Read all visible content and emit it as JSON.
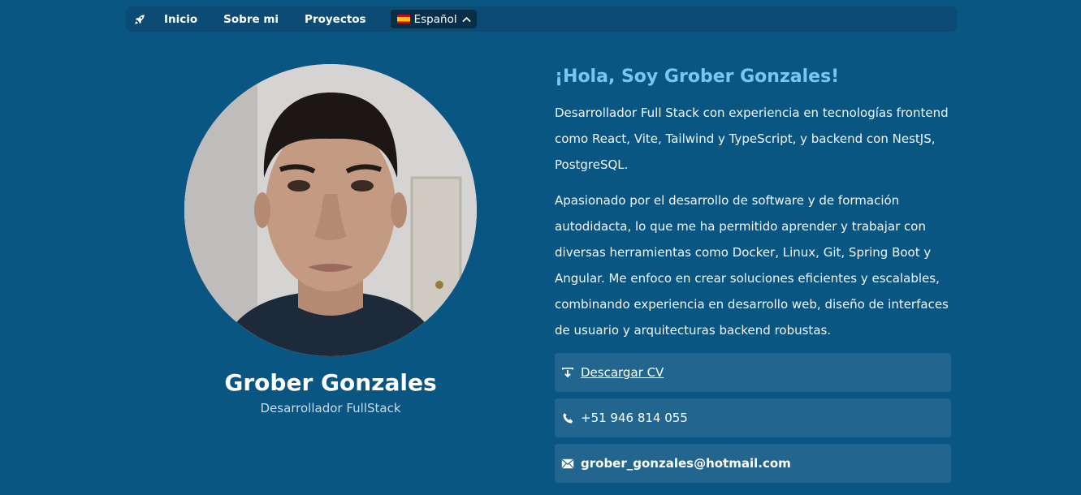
{
  "nav": {
    "logo_icon": "rocket-icon",
    "links": [
      {
        "label": "Inicio"
      },
      {
        "label": "Sobre mi"
      },
      {
        "label": "Proyectos"
      }
    ],
    "language": {
      "label": "Español",
      "flag_icon": "spain-flag-icon",
      "chevron_icon": "chevron-up-icon"
    }
  },
  "profile": {
    "name": "Grober Gonzales",
    "role": "Desarrollador FullStack"
  },
  "about": {
    "greeting": "¡Hola, Soy Grober Gonzales!",
    "paragraph1": "Desarrollador Full Stack con experiencia en tecnologías frontend como React, Vite, Tailwind y TypeScript, y backend con NestJS, PostgreSQL.",
    "paragraph2": "Apasionado por el desarrollo de software y de formación autodidacta, lo que me ha permitido aprender y trabajar con diversas herramientas como Docker, Linux, Git, Spring Boot y Angular. Me enfoco en crear soluciones eficientes y escalables, combinando experiencia en desarrollo web, diseño de interfaces de usuario y arquitecturas backend robustas."
  },
  "contacts": {
    "cv_label": "Descargar CV",
    "phone": "+51 946 814 055",
    "email": "grober_gonzales@hotmail.com"
  },
  "colors": {
    "background": "#0a5683",
    "navbar": "#0c4c74",
    "accent": "#7cc4f2",
    "card": "#22668f"
  }
}
